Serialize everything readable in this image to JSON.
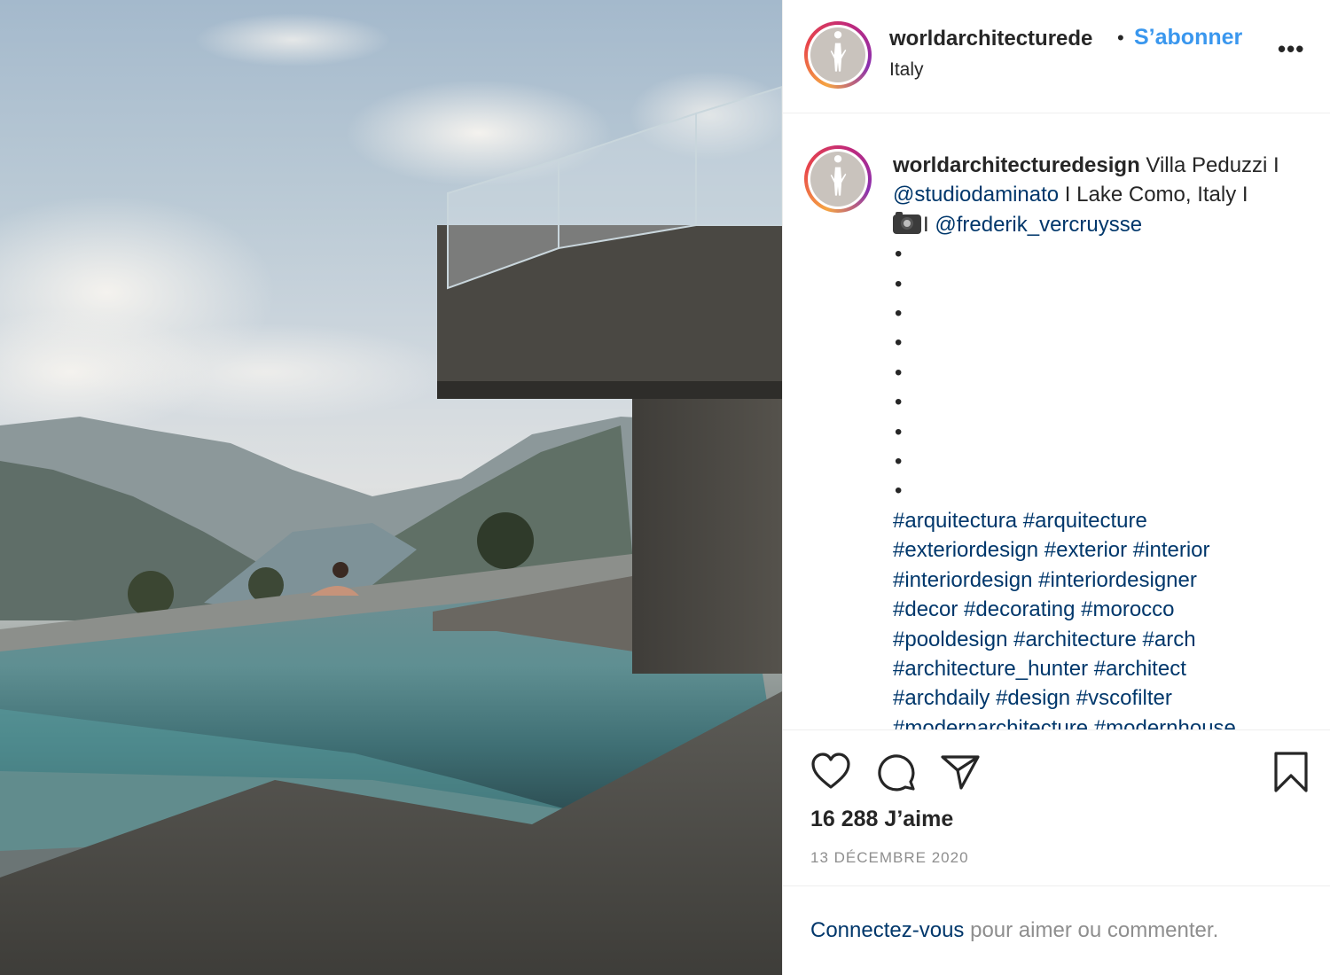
{
  "post": {
    "username": "worldarchitecturede",
    "separator": "•",
    "follow_label": "S’abonner",
    "location": "Italy",
    "more_label": "•••"
  },
  "caption": {
    "username": "worldarchitecturedesign",
    "text1": " Villa Peduzzi I ",
    "mention1": "@studiodaminato",
    "text2": " I Lake Como, Italy I ",
    "text3": "I ",
    "mention2": "@frederik_vercruysse",
    "dot": "•",
    "hashtag_lines": [
      "#arquitectura #arquitecture",
      "#exteriordesign #exterior #interior",
      "#interiordesign #interiordesigner",
      "#decor #decorating #morocco",
      "#pooldesign #architecture #arch",
      "#architecture_hunter #architect",
      "#archdaily #design #vscofilter",
      "#modernarchitecture #modernhouse"
    ]
  },
  "actions": {
    "like_icon": "heart-icon",
    "comment_icon": "comment-icon",
    "share_icon": "paper-plane-icon",
    "save_icon": "bookmark-icon"
  },
  "likes": "16 288 J’aime",
  "date": "13 DÉCEMBRE 2020",
  "login": {
    "link": "Connectez-vous",
    "text": " pour aimer ou commenter."
  },
  "colors": {
    "follow": "#3a97ee",
    "link": "#00376b",
    "muted": "#8e8e8e"
  }
}
